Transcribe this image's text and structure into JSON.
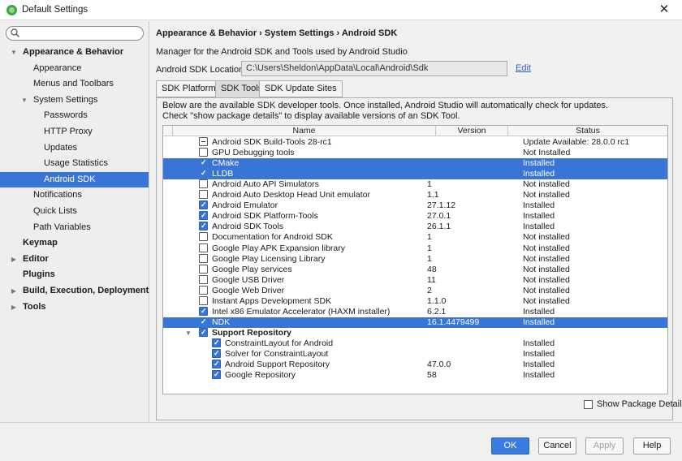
{
  "window": {
    "title": "Default Settings",
    "close_glyph": "✕"
  },
  "search": {
    "placeholder": "",
    "value": ""
  },
  "sidebar": {
    "items": [
      {
        "label": "Appearance & Behavior",
        "bold": true,
        "arrow": "▼"
      },
      {
        "label": "Appearance"
      },
      {
        "label": "Menus and Toolbars"
      },
      {
        "label": "System Settings",
        "arrow": "▼"
      },
      {
        "label": "Passwords"
      },
      {
        "label": "HTTP Proxy"
      },
      {
        "label": "Updates"
      },
      {
        "label": "Usage Statistics"
      },
      {
        "label": "Android SDK",
        "selected": true
      },
      {
        "label": "Notifications"
      },
      {
        "label": "Quick Lists"
      },
      {
        "label": "Path Variables"
      },
      {
        "label": "Keymap",
        "bold": true
      },
      {
        "label": "Editor",
        "bold": true,
        "arrow": "▶"
      },
      {
        "label": "Plugins",
        "bold": true
      },
      {
        "label": "Build, Execution, Deployment",
        "bold": true,
        "arrow": "▶"
      },
      {
        "label": "Tools",
        "bold": true,
        "arrow": "▶"
      }
    ]
  },
  "main": {
    "breadcrumb": "Appearance & Behavior › System Settings › Android SDK",
    "description": "Manager for the Android SDK and Tools used by Android Studio",
    "sdk_location_label": "Android SDK Location:",
    "sdk_location_value": "C:\\Users\\Sheldon\\AppData\\Local\\Android\\Sdk",
    "edit_link": "Edit",
    "tabs": [
      {
        "label": "SDK Platforms"
      },
      {
        "label": "SDK Tools",
        "active": true
      },
      {
        "label": "SDK Update Sites"
      }
    ],
    "info_line1": "Below are the available SDK developer tools. Once installed, Android Studio will automatically check for updates.",
    "info_line2": "Check \"show package details\" to display available versions of an SDK Tool.",
    "columns": {
      "name": "Name",
      "version": "Version",
      "status": "Status"
    },
    "rows": [
      {
        "name": "Android SDK Build-Tools 28-rc1",
        "version": "",
        "status": "Update Available: 28.0.0 rc1",
        "check": "partial"
      },
      {
        "name": "GPU Debugging tools",
        "version": "",
        "status": "Not Installed",
        "check": "none"
      },
      {
        "name": "CMake",
        "version": "",
        "status": "Installed",
        "check": "checked",
        "selected": true
      },
      {
        "name": "LLDB",
        "version": "",
        "status": "Installed",
        "check": "checked",
        "selected": true
      },
      {
        "name": "Android Auto API Simulators",
        "version": "1",
        "status": "Not installed",
        "check": "none"
      },
      {
        "name": "Android Auto Desktop Head Unit emulator",
        "version": "1.1",
        "status": "Not installed",
        "check": "none"
      },
      {
        "name": "Android Emulator",
        "version": "27.1.12",
        "status": "Installed",
        "check": "checked"
      },
      {
        "name": "Android SDK Platform-Tools",
        "version": "27.0.1",
        "status": "Installed",
        "check": "checked"
      },
      {
        "name": "Android SDK Tools",
        "version": "26.1.1",
        "status": "Installed",
        "check": "checked"
      },
      {
        "name": "Documentation for Android SDK",
        "version": "1",
        "status": "Not installed",
        "check": "none"
      },
      {
        "name": "Google Play APK Expansion library",
        "version": "1",
        "status": "Not installed",
        "check": "none"
      },
      {
        "name": "Google Play Licensing Library",
        "version": "1",
        "status": "Not installed",
        "check": "none"
      },
      {
        "name": "Google Play services",
        "version": "48",
        "status": "Not installed",
        "check": "none"
      },
      {
        "name": "Google USB Driver",
        "version": "11",
        "status": "Not installed",
        "check": "none"
      },
      {
        "name": "Google Web Driver",
        "version": "2",
        "status": "Not installed",
        "check": "none"
      },
      {
        "name": "Instant Apps Development SDK",
        "version": "1.1.0",
        "status": "Not installed",
        "check": "none"
      },
      {
        "name": "Intel x86 Emulator Accelerator (HAXM installer)",
        "version": "6.2.1",
        "status": "Installed",
        "check": "checked"
      },
      {
        "name": "NDK",
        "version": "16.1.4479499",
        "status": "Installed",
        "check": "checked",
        "selected": true
      },
      {
        "name": "Support Repository",
        "version": "",
        "status": "",
        "check": "checked",
        "group": true,
        "expand": "▼"
      },
      {
        "name": "ConstraintLayout for Android",
        "version": "",
        "status": "Installed",
        "check": "checked",
        "child": true
      },
      {
        "name": "Solver for ConstraintLayout",
        "version": "",
        "status": "Installed",
        "check": "checked",
        "child": true
      },
      {
        "name": "Android Support Repository",
        "version": "47.0.0",
        "status": "Installed",
        "check": "checked",
        "child": true
      },
      {
        "name": "Google Repository",
        "version": "58",
        "status": "Installed",
        "check": "checked",
        "child": true
      }
    ],
    "show_package_details": "Show Package Details"
  },
  "footer": {
    "ok": "OK",
    "cancel": "Cancel",
    "apply": "Apply",
    "help": "Help"
  },
  "colors": {
    "selection": "#3875d6",
    "link": "#2f5fc9",
    "primary_button": "#3a7be0"
  }
}
